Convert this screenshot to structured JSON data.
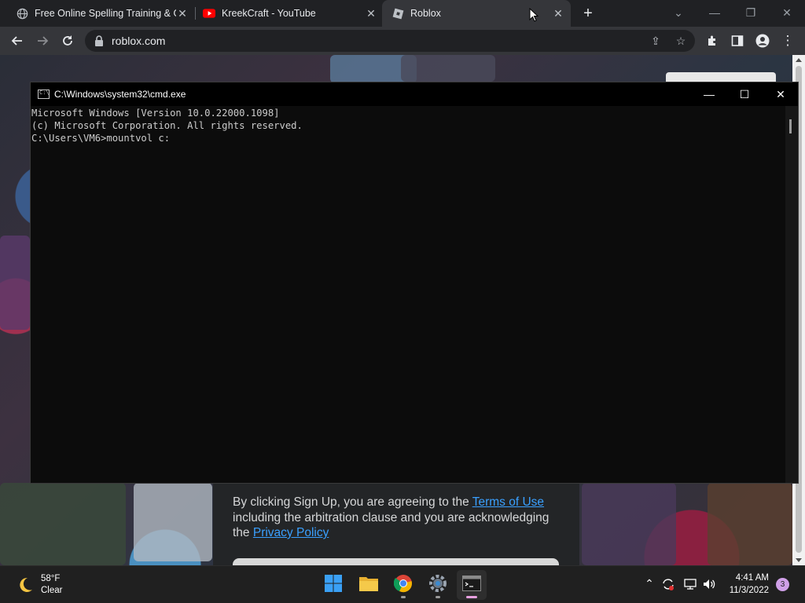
{
  "browser": {
    "tabs": [
      {
        "title": "Free Online Spelling Training & G",
        "icon": "globe-icon"
      },
      {
        "title": "KreekCraft - YouTube",
        "icon": "youtube-icon"
      },
      {
        "title": "Roblox",
        "icon": "roblox-icon",
        "active": true
      }
    ],
    "tab_close_glyph": "✕",
    "new_tab_glyph": "+",
    "url": "roblox.com"
  },
  "page": {
    "signup_prefix": "By clicking Sign Up, you are agreeing to the ",
    "terms_link": "Terms of Use",
    "signup_middle": " including the arbitration clause and you are acknowledging the ",
    "privacy_link": "Privacy Policy"
  },
  "cmd": {
    "title": "C:\\Windows\\system32\\cmd.exe",
    "lines": [
      "Microsoft Windows [Version 10.0.22000.1098]",
      "(c) Microsoft Corporation. All rights reserved.",
      "C:\\Users\\VM6>mountvol c:"
    ],
    "icon_text": "C:\\"
  },
  "taskbar": {
    "weather_temp": "58°F",
    "weather_condition": "Clear",
    "time": "4:41 AM",
    "date": "11/3/2022",
    "notification_count": "3"
  },
  "colors": {
    "link": "#3aa0ff",
    "chrome_bg": "#202124",
    "toolbar_bg": "#35363a"
  }
}
